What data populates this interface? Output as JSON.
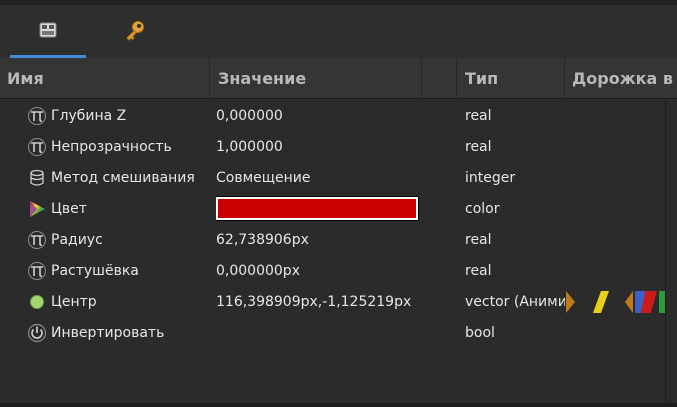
{
  "tabs": [
    {
      "icon": "params-icon",
      "selected": true
    },
    {
      "icon": "key-icon",
      "selected": false
    }
  ],
  "columns": {
    "name": "Имя",
    "value": "Значение",
    "type": "Тип",
    "track": "Дорожка в"
  },
  "rows": [
    {
      "icon": "pi-icon",
      "name": "Глубина Z",
      "value": "0,000000",
      "type": "real"
    },
    {
      "icon": "pi-icon",
      "name": "Непрозрачность",
      "value": "1,000000",
      "type": "real"
    },
    {
      "icon": "blend-method-icon",
      "name": "Метод смешивания",
      "value": "Совмещение",
      "type": "integer"
    },
    {
      "icon": "color-triangle-icon",
      "name": "Цвет",
      "value": "",
      "type": "color",
      "swatch": "#cc0000"
    },
    {
      "icon": "pi-icon",
      "name": "Радиус",
      "value": "62,738906px",
      "type": "real"
    },
    {
      "icon": "pi-icon",
      "name": "Растушёвка",
      "value": "0,000000px",
      "type": "real"
    },
    {
      "icon": "vector-dot-icon",
      "name": "Центр",
      "value": "116,398909px,-1,125219px",
      "type": "vector (Анимированный)"
    },
    {
      "icon": "bool-icon",
      "name": "Инвертировать",
      "value": "",
      "type": "bool"
    }
  ],
  "waypoint_colors": [
    "#c07a1a",
    "#e6d21a",
    "#c07a1a",
    "#3a5fc8",
    "#cc1b1b",
    "#2a9a3a"
  ]
}
